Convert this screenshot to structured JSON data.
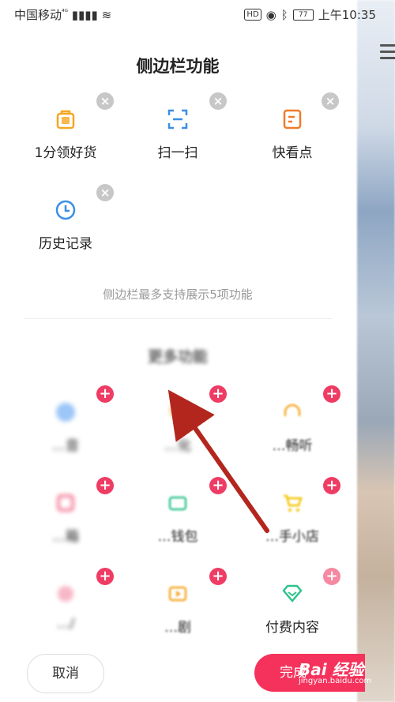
{
  "status": {
    "carrier": "中国移动",
    "network": "⁴ᴳ",
    "hd": "HD",
    "battery": "77",
    "time": "上午10:35"
  },
  "panel": {
    "title": "侧边栏功能",
    "selected": [
      {
        "label": "1分领好货",
        "icon": "gift-bag-icon",
        "color": "#f5a623"
      },
      {
        "label": "扫一扫",
        "icon": "scan-icon",
        "color": "#3a8ee6"
      },
      {
        "label": "快看点",
        "icon": "document-icon",
        "color": "#f07a2a"
      },
      {
        "label": "历史记录",
        "icon": "clock-icon",
        "color": "#3a8ee6"
      }
    ],
    "hint": "侧边栏最多支持展示5项功能",
    "more_title": "更多功能",
    "more": [
      {
        "label": "…音",
        "icon": "circle-icon",
        "color": "#5aa0f2"
      },
      {
        "label": "…化",
        "icon": "bulb-icon",
        "color": "#f5a623"
      },
      {
        "label": "…畅听",
        "icon": "headphones-icon",
        "color": "#f5a623"
      },
      {
        "label": "…箱",
        "icon": "box-icon",
        "color": "#ef3c64"
      },
      {
        "label": "…钱包",
        "icon": "wallet-icon",
        "color": "#2fc38c"
      },
      {
        "label": "…手小店",
        "icon": "cart-icon",
        "color": "#f5c400"
      },
      {
        "label": "…/",
        "icon": "heart-icon",
        "color": "#ef6f8d"
      },
      {
        "label": "…剧",
        "icon": "play-icon",
        "color": "#f5a623"
      },
      {
        "label": "付费内容",
        "icon": "diamond-icon",
        "color": "#2fc38c"
      }
    ]
  },
  "buttons": {
    "cancel": "取消",
    "done": "完成"
  },
  "watermark": {
    "main": "Bai 经验",
    "sub": "jingyan.baidu.com"
  }
}
